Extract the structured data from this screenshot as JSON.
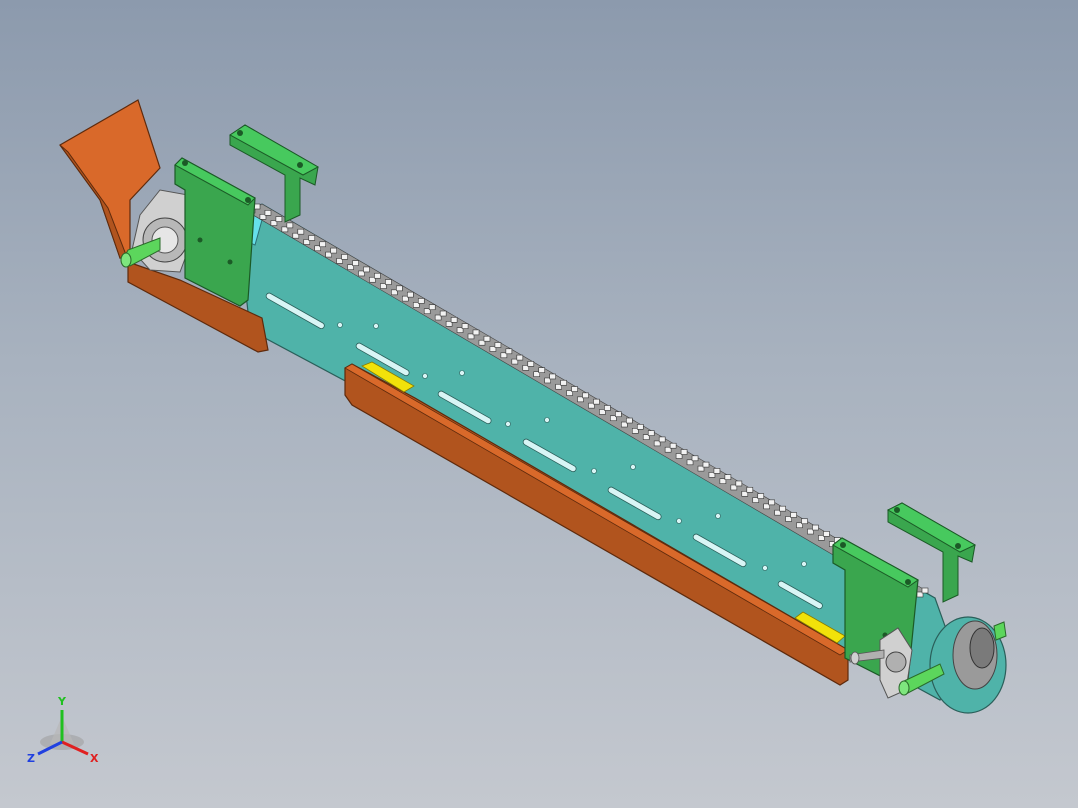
{
  "viewport": {
    "background_top": "#8c9aad",
    "background_bottom": "#c4c8cf"
  },
  "model": {
    "colors": {
      "frame": "#4fb3a9",
      "frame_top": "#5fd6e6",
      "guard": "#b1541e",
      "guard_top": "#d9692a",
      "bracket": "#3aa64e",
      "bracket_top": "#47c95e",
      "bearing": "#c8c8c8",
      "shaft": "#5cd65c",
      "chain": "#8a8a8a",
      "indicator": "#f2e20a"
    }
  },
  "triad": {
    "x_label": "X",
    "y_label": "Y",
    "z_label": "Z",
    "x_color": "#e02020",
    "y_color": "#20c020",
    "z_color": "#2040e0"
  }
}
